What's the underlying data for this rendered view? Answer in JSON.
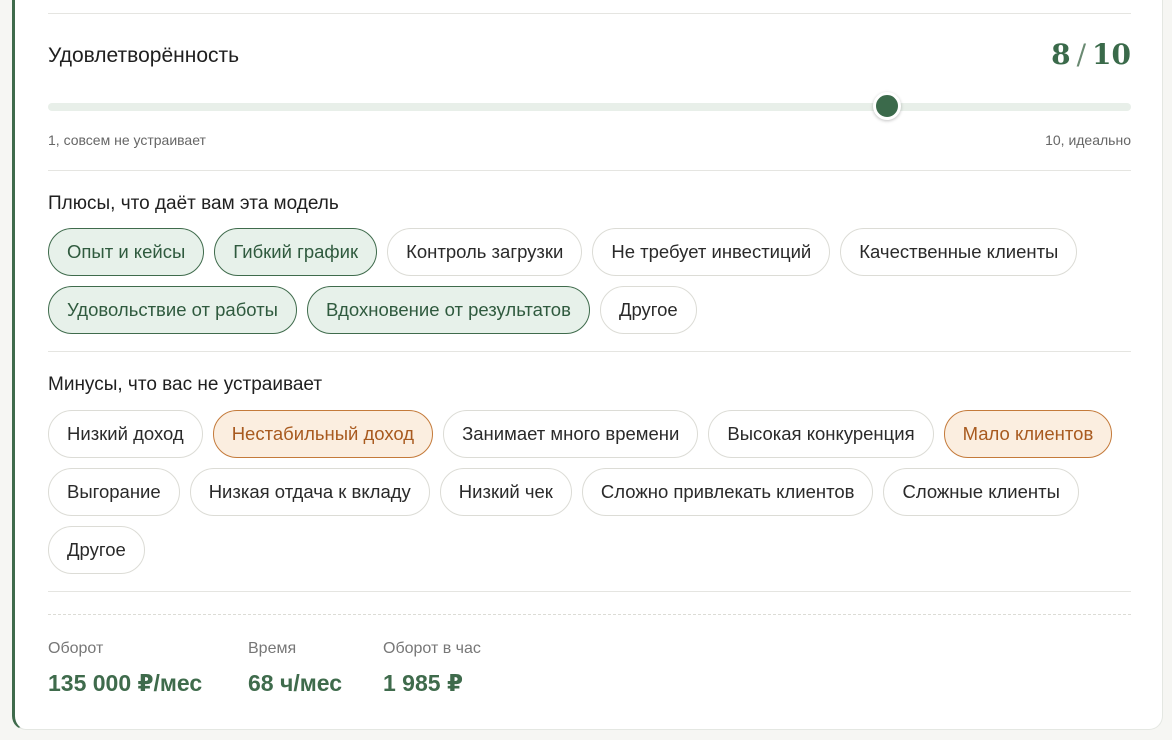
{
  "satisfaction": {
    "label": "Удовлетворённость",
    "value": 8,
    "max": 10,
    "score_value": "8",
    "score_sep": "/",
    "score_max": "10",
    "min_label": "1, совсем не устраивает",
    "max_label": "10, идеально"
  },
  "pros": {
    "title": "Плюсы, что даёт вам эта модель",
    "chips": [
      {
        "label": "Опыт и кейсы",
        "selected": true
      },
      {
        "label": "Гибкий график",
        "selected": true
      },
      {
        "label": "Контроль загрузки",
        "selected": false
      },
      {
        "label": "Не требует инвестиций",
        "selected": false
      },
      {
        "label": "Качественные клиенты",
        "selected": false
      },
      {
        "label": "Удовольствие от работы",
        "selected": true
      },
      {
        "label": "Вдохновение от результатов",
        "selected": true
      },
      {
        "label": "Другое",
        "selected": false
      }
    ]
  },
  "cons": {
    "title": "Минусы, что вас не устраивает",
    "chips": [
      {
        "label": "Низкий доход",
        "selected": false
      },
      {
        "label": "Нестабильный доход",
        "selected": true
      },
      {
        "label": "Занимает много времени",
        "selected": false
      },
      {
        "label": "Высокая конкуренция",
        "selected": false
      },
      {
        "label": "Мало клиентов",
        "selected": true
      },
      {
        "label": "Выгорание",
        "selected": false
      },
      {
        "label": "Низкая отдача к вкладу",
        "selected": false
      },
      {
        "label": "Низкий чек",
        "selected": false
      },
      {
        "label": "Сложно привлекать клиентов",
        "selected": false
      },
      {
        "label": "Сложные клиенты",
        "selected": false
      },
      {
        "label": "Другое",
        "selected": false
      }
    ]
  },
  "stats": {
    "turnover": {
      "label": "Оборот",
      "value": "135 000 ₽/мес"
    },
    "time": {
      "label": "Время",
      "value": "68 ч/мес"
    },
    "per_hour": {
      "label": "Оборот в час",
      "value": "1 985 ₽"
    }
  },
  "colors": {
    "accent_green": "#3f6b4c",
    "selected_green_bg": "#e7f1ea",
    "selected_orange_border": "#c47a3a",
    "selected_orange_bg": "#fbeee0"
  }
}
